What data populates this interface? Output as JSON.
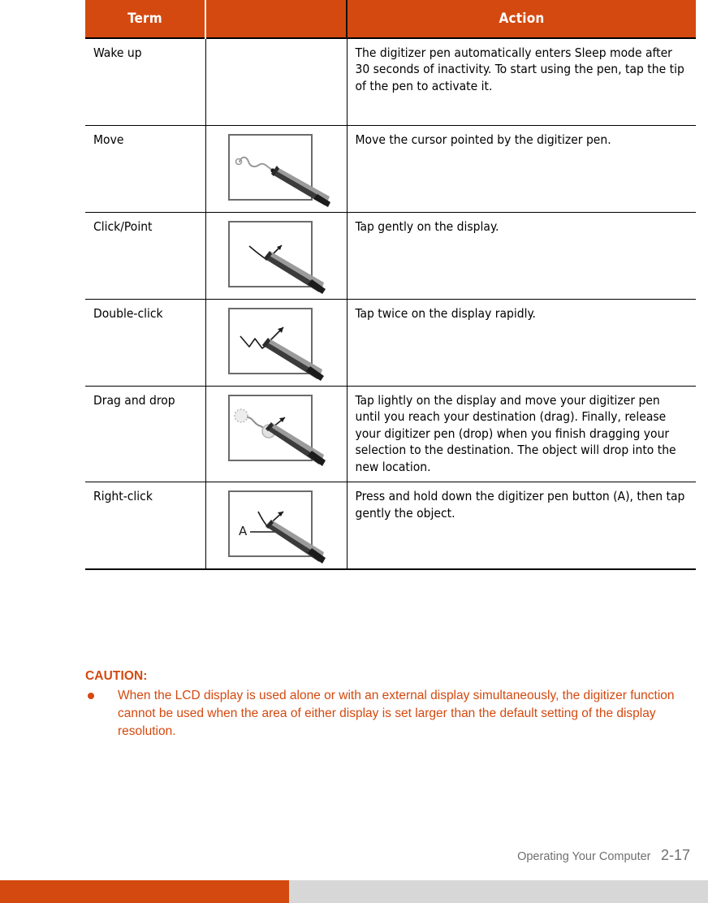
{
  "document": {
    "table": {
      "headers": [
        "Term",
        "",
        "Action"
      ],
      "rows": [
        {
          "term": "Wake up",
          "figure": "none",
          "figure_name": "no-illustration",
          "action": "The digitizer pen automatically enters Sleep mode after 30 seconds of inactivity. To start using the pen, tap the tip of the pen to activate it."
        },
        {
          "term": "Move",
          "figure": "pen-move-wavy-line",
          "figure_name": "digitizer-pen-move-illustration",
          "action": "Move the cursor pointed by the digitizer pen."
        },
        {
          "term": "Click/Point",
          "figure": "pen-single-tap",
          "figure_name": "digitizer-pen-click-illustration",
          "action": "Tap gently on the display."
        },
        {
          "term": "Double-click",
          "figure": "pen-double-tap",
          "figure_name": "digitizer-pen-double-click-illustration",
          "action": "Tap twice on the display rapidly."
        },
        {
          "term": "Drag and drop",
          "figure": "pen-drag-drop",
          "figure_name": "digitizer-pen-drag-drop-illustration",
          "action": "Tap lightly on the display and move your digitizer pen until you reach your destination (drag). Finally, release your digitizer pen (drop) when you finish dragging your selection to the destination. The object will drop into the new location."
        },
        {
          "term": "Right-click",
          "figure": "pen-right-click",
          "figure_name": "digitizer-pen-right-click-illustration",
          "figure_label": "A",
          "action": "Press and hold down the digitizer pen button (A), then tap gently the object."
        }
      ]
    },
    "caution": {
      "title": "CAUTION:",
      "items": [
        "When the LCD display is used alone or with an external display simultaneously, the digitizer function cannot be used when the area of either display is set larger than the default setting of the display resolution."
      ]
    },
    "footer": {
      "chapter": "Operating Your Computer",
      "page": "2-17"
    },
    "colors": {
      "accent_orange": "#d4490f",
      "bottom_bar_grey": "#d7d7d7",
      "footer_text": "#6f6f6f",
      "table_border": "#000000"
    }
  }
}
